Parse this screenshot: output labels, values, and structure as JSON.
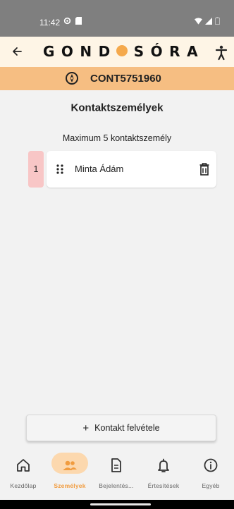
{
  "status_bar": {
    "time": "11:42",
    "icons": [
      "settings-gear-icon",
      "sd-card-icon",
      "wifi-icon",
      "signal-icon",
      "battery-icon"
    ]
  },
  "header": {
    "logo_left": "GOND",
    "logo_right": "SÓRA",
    "accent_color": "#f5a94c"
  },
  "contract": {
    "id": "CONT5751960"
  },
  "section": {
    "title": "Kontaktszemélyek",
    "subtitle": "Maximum 5 kontaktszemély"
  },
  "contacts": [
    {
      "index": "1",
      "name": "Minta Ádám"
    }
  ],
  "add_button": {
    "icon": "+",
    "label": "Kontakt felvétele"
  },
  "bottom_nav": {
    "items": [
      {
        "label": "Kezdőlap",
        "icon": "home-icon",
        "active": false
      },
      {
        "label": "Személyek",
        "icon": "people-icon",
        "active": true
      },
      {
        "label": "Bejelentés...",
        "icon": "document-icon",
        "active": false
      },
      {
        "label": "Értesítések",
        "icon": "bell-icon",
        "active": false
      },
      {
        "label": "Egyéb",
        "icon": "info-icon",
        "active": false
      }
    ],
    "active_color": "#f19c3f"
  }
}
